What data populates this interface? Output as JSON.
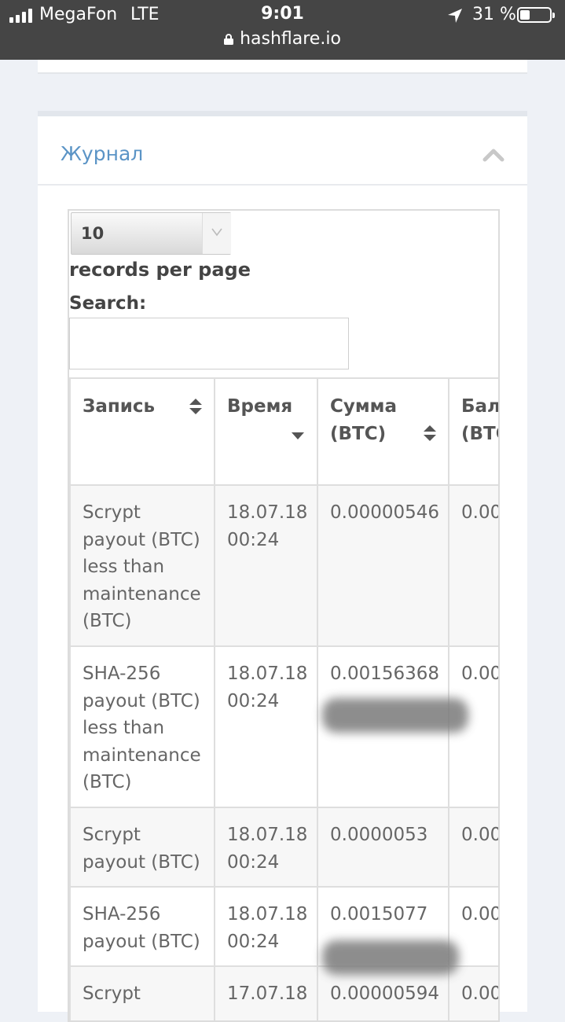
{
  "status_bar": {
    "carrier": "MegaFon",
    "network": "LTE",
    "time": "9:01",
    "battery": "31 %",
    "battery_level": 0.31,
    "url": "hashflare.io"
  },
  "journal": {
    "title": "Журнал",
    "page_length": "10",
    "page_length_label": "records per page",
    "search_label": "Search:",
    "search_value": "",
    "columns": [
      "Запись",
      "Время",
      "Сумма (BTC)",
      "Бал (BTC"
    ],
    "rows": [
      {
        "entry": "Scrypt payout (BTC) less than maintenance (BTC)",
        "time": "18.07.18 00:24",
        "amount": "0.00000546",
        "balance": "0.00",
        "highlight": true
      },
      {
        "entry": "SHA-256 payout (BTC) less than maintenance (BTC)",
        "time": "18.07.18 00:24",
        "amount": "0.00156368",
        "balance": "0.00",
        "highlight": true
      },
      {
        "entry": "Scrypt payout (BTC)",
        "time": "18.07.18 00:24",
        "amount": "0.0000053",
        "balance": "0.00",
        "highlight": false
      },
      {
        "entry": "SHA-256 payout (BTC)",
        "time": "18.07.18 00:24",
        "amount": "0.0015077",
        "balance": "0.00",
        "highlight": false
      },
      {
        "entry": "Scrypt",
        "time": "17.07.18",
        "amount": "0.00000594",
        "balance": "0.00",
        "highlight": true
      }
    ]
  },
  "colors": {
    "status_bg": "#454545",
    "page_bg": "#eef1f6",
    "title_blue": "#5b94c6",
    "debit_pink": "#e0709d"
  }
}
